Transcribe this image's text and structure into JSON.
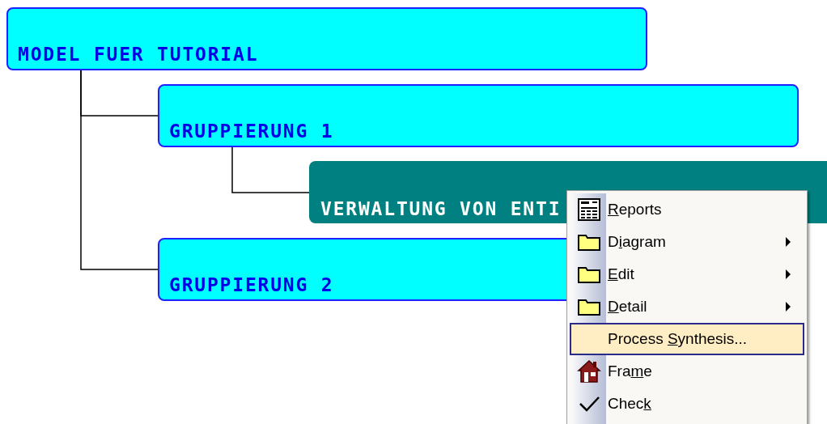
{
  "diagram": {
    "nodes": [
      {
        "label": "MODEL FUER TUTORIAL",
        "selected": false,
        "children": [
          {
            "label": "GRUPPIERUNG 1",
            "selected": false,
            "children": [
              {
                "label": "VERWALTUNG VON ENTI",
                "selected": true
              }
            ]
          },
          {
            "label": "GRUPPIERUNG 2",
            "selected": false
          }
        ]
      }
    ]
  },
  "context_menu": {
    "items": [
      {
        "kind": "report",
        "label": [
          {
            "text": "R",
            "underline": true
          },
          {
            "text": "eports",
            "underline": false
          }
        ],
        "submenu": false,
        "selected": false
      },
      {
        "kind": "folder",
        "label": [
          {
            "text": "D",
            "underline": false
          },
          {
            "text": "i",
            "underline": true
          },
          {
            "text": "agram",
            "underline": false
          }
        ],
        "submenu": true,
        "selected": false
      },
      {
        "kind": "folder",
        "label": [
          {
            "text": "E",
            "underline": true
          },
          {
            "text": "dit",
            "underline": false
          }
        ],
        "submenu": true,
        "selected": false
      },
      {
        "kind": "folder",
        "label": [
          {
            "text": "D",
            "underline": true
          },
          {
            "text": "etail",
            "underline": false
          }
        ],
        "submenu": true,
        "selected": false
      },
      {
        "kind": "plain",
        "label": [
          {
            "text": "Process ",
            "underline": false
          },
          {
            "text": "S",
            "underline": true
          },
          {
            "text": "ynthesis...",
            "underline": false
          }
        ],
        "submenu": false,
        "selected": true
      },
      {
        "kind": "frame",
        "label": [
          {
            "text": "Fra",
            "underline": false
          },
          {
            "text": "m",
            "underline": true
          },
          {
            "text": "e",
            "underline": false
          }
        ],
        "submenu": false,
        "selected": false
      },
      {
        "kind": "check",
        "label": [
          {
            "text": "Chec",
            "underline": false
          },
          {
            "text": "k",
            "underline": true
          }
        ],
        "submenu": false,
        "selected": false
      }
    ]
  }
}
